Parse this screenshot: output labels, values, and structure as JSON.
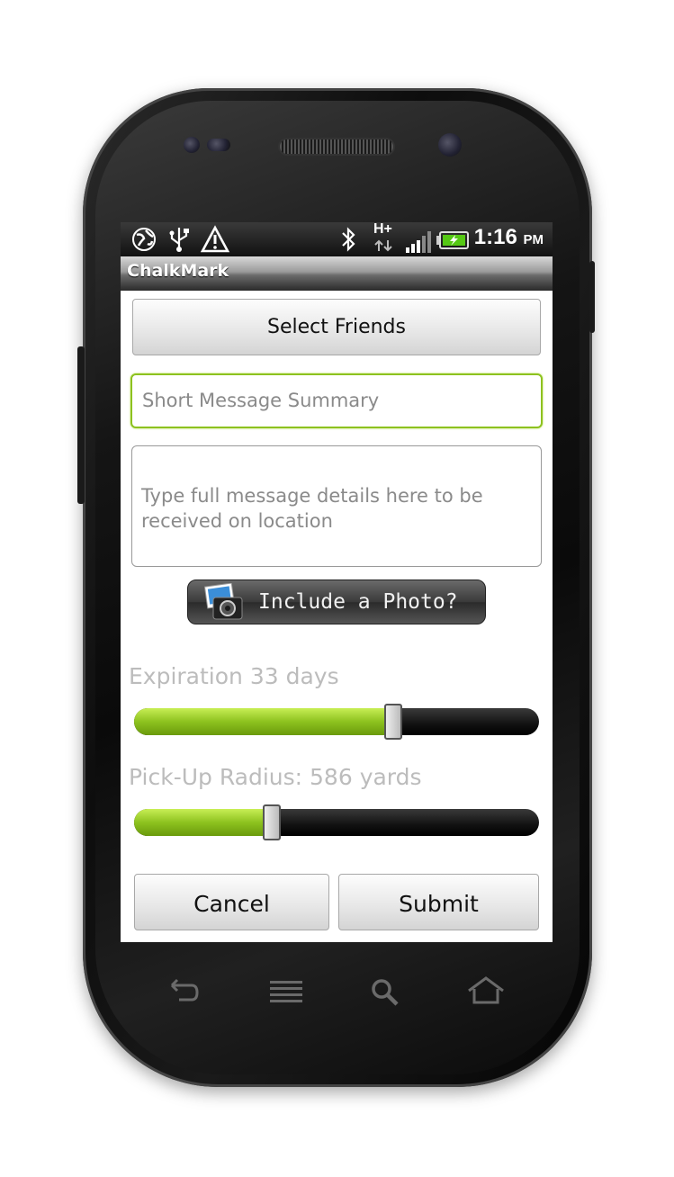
{
  "statusbar": {
    "time": "1:16",
    "ampm": "PM",
    "network": "H+"
  },
  "app": {
    "title": "ChalkMark"
  },
  "form": {
    "select_friends_label": "Select Friends",
    "summary_placeholder": "Short Message Summary",
    "details_placeholder": "Type full message details here to be received on location",
    "photo_button_label": "Include a Photo?",
    "expiration_label": "Expiration 33 days",
    "expiration_fraction": 0.64,
    "radius_label": "Pick-Up Radius: 586 yards",
    "radius_fraction": 0.34,
    "cancel_label": "Cancel",
    "submit_label": "Submit"
  },
  "colors": {
    "accent_green": "#8dc21f",
    "focus_border": "#8dc21f"
  },
  "icons": [
    "globe-icon",
    "usb-icon",
    "warning-icon",
    "bluetooth-icon",
    "signal-icon",
    "battery-icon",
    "back-icon",
    "menu-icon",
    "search-icon",
    "home-icon",
    "photo-camera-icon"
  ]
}
